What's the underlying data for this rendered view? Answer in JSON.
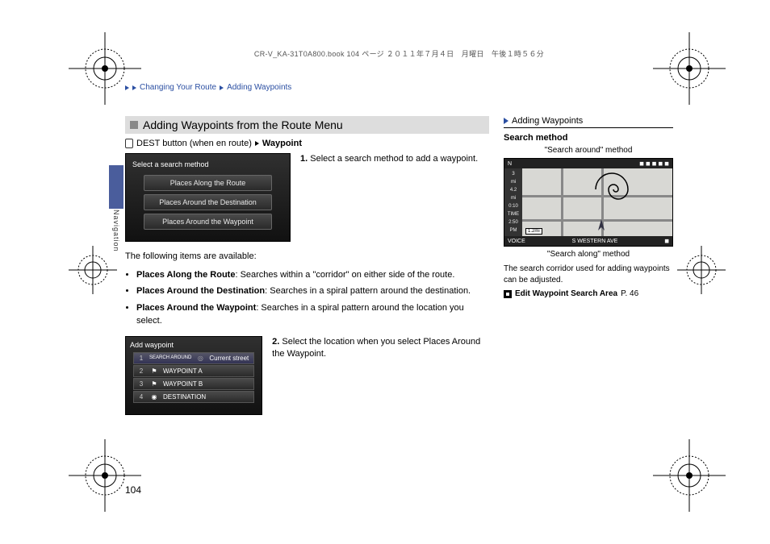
{
  "print_header": "CR-V_KA-31T0A800.book  104 ページ  ２０１１年７月４日　月曜日　午後１時５６分",
  "breadcrumb": {
    "item1": "Changing Your Route",
    "item2": "Adding Waypoints"
  },
  "side_tab_label": "Navigation",
  "section": {
    "title": "Adding Waypoints from the Route Menu",
    "nav_pre": "DEST button (when en route)",
    "nav_link": "Waypoint"
  },
  "screenshot1": {
    "header": "Select a search method",
    "options": [
      "Places Along the Route",
      "Places Around the Destination",
      "Places Around the Waypoint"
    ]
  },
  "step1": {
    "num": "1.",
    "text": "Select a search method to add a waypoint."
  },
  "intro2": "The following items are available:",
  "bullets": [
    {
      "label": "Places Along the Route",
      "desc": ": Searches within a \"corridor\" on either side of the route."
    },
    {
      "label": "Places Around the Destination",
      "desc": ": Searches in a spiral pattern around the destination."
    },
    {
      "label": "Places Around the Waypoint",
      "desc": ": Searches in a spiral pattern around the location you select."
    }
  ],
  "screenshot2": {
    "header": "Add waypoint",
    "rows": [
      {
        "idx": "1",
        "flag": "",
        "label": "Current street",
        "kind": "search"
      },
      {
        "idx": "2",
        "flag": "⚑",
        "label": "WAYPOINT A",
        "kind": "wp"
      },
      {
        "idx": "3",
        "flag": "⚑",
        "label": "WAYPOINT B",
        "kind": "wp"
      },
      {
        "idx": "4",
        "flag": "◉",
        "label": "DESTINATION",
        "kind": "dest"
      }
    ],
    "search_label": "SEARCH AROUND"
  },
  "step2": {
    "num": "2.",
    "pre": "Select the location when you select ",
    "bold": "Places Around the Waypoint",
    "post": "."
  },
  "sidebar": {
    "heading": "Adding Waypoints",
    "sub": "Search method",
    "caption_top": "\"Search around\" method",
    "caption_bottom": "\"Search along\" method",
    "map": {
      "street": "S WESTERN AVE",
      "voice": "VOICE",
      "left_items": [
        "3",
        "mi",
        "4.2",
        "mi",
        "0:10",
        "TIME",
        "2:50",
        "PM"
      ],
      "scale": "1.2mi",
      "north": "N"
    },
    "note": "The search corridor used for adding waypoints can be adjusted.",
    "ref_label": "Edit Waypoint Search Area",
    "ref_page": "P. 46"
  },
  "page_number": "104"
}
